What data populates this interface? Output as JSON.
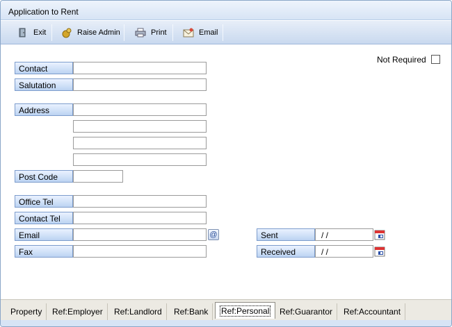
{
  "window": {
    "title": "Application to Rent"
  },
  "toolbar": {
    "exit": "Exit",
    "raise_admin": "Raise Admin",
    "print": "Print",
    "email": "Email"
  },
  "form": {
    "not_required": "Not Required",
    "contact_label": "Contact",
    "salutation_label": "Salutation",
    "address_label": "Address",
    "postcode_label": "Post Code",
    "office_tel_label": "Office Tel",
    "contact_tel_label": "Contact Tel",
    "email_label": "Email",
    "fax_label": "Fax",
    "sent_label": "Sent",
    "received_label": "Received",
    "sent_value": " / /",
    "received_value": " / /"
  },
  "tabs": [
    "Property",
    "Ref:Employer",
    "Ref:Landlord",
    "Ref:Bank",
    "Ref:Personal",
    "Ref:Guarantor",
    "Ref:Accountant"
  ],
  "active_tab": "Ref:Personal",
  "colors": {
    "accent": "#bcd3f2",
    "frame": "#8aa6c8"
  }
}
